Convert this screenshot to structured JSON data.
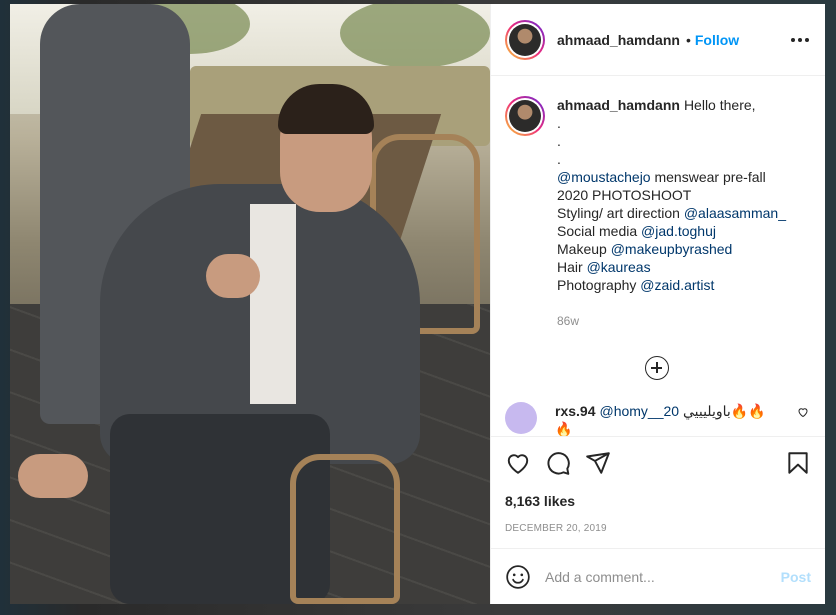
{
  "post": {
    "username": "ahmaad_hamdann",
    "follow_label": "Follow",
    "dot": "•"
  },
  "caption": {
    "username": "ahmaad_hamdann",
    "lines": [
      "Hello there,",
      ".",
      ".",
      "."
    ],
    "credits": [
      {
        "mention": "@moustachejo",
        "text": " menswear pre-fall"
      },
      {
        "mention": "",
        "text": "2020 PHOTOSHOOT"
      },
      {
        "prefix": "Styling/ art direction ",
        "mention": "@alaasamman_"
      },
      {
        "prefix": "Social media ",
        "mention": "@jad.toghuj"
      },
      {
        "prefix": "Makeup ",
        "mention": "@makeupbyrashed"
      },
      {
        "prefix": "Hair ",
        "mention": "@kaureas"
      },
      {
        "prefix": "Photography ",
        "mention": "@zaid.artist"
      }
    ],
    "time": "86w"
  },
  "comments": [
    {
      "username": "rxs.94",
      "mention": "@homy__20",
      "text": " باويليييي🔥🔥",
      "text2": "🔥"
    }
  ],
  "actions": {
    "likes": "8,163 likes",
    "date": "DECEMBER 20, 2019"
  },
  "add_comment": {
    "placeholder": "Add a comment...",
    "post_label": "Post"
  },
  "colors": {
    "link": "#0095f6",
    "mention": "#00376b",
    "muted": "#8e8e8e",
    "post_disabled": "#b2dffc",
    "comment_avatar": "#c7b9ef"
  }
}
